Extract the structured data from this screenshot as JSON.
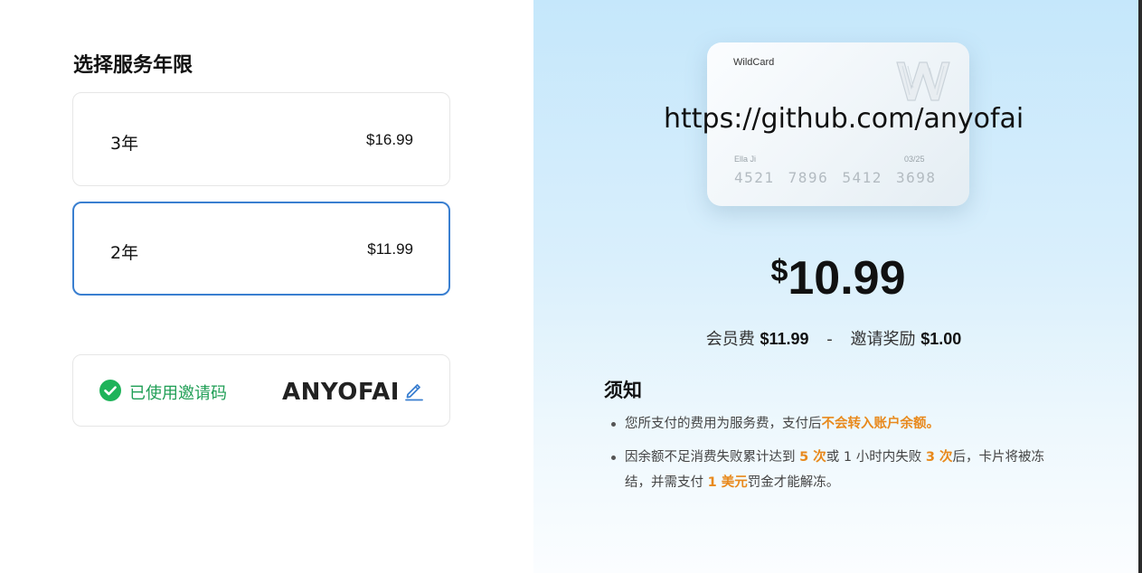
{
  "plan_section": {
    "title": "选择服务年限",
    "options": [
      {
        "label": "3年",
        "price": "$16.99",
        "selected": false
      },
      {
        "label": "2年",
        "price": "$11.99",
        "selected": true
      }
    ]
  },
  "invite": {
    "status_text": "已使用邀请码",
    "code": "ANYOFAI",
    "status_icon": "check-circle-icon",
    "edit_icon": "pencil-icon"
  },
  "card": {
    "brand": "WildCard",
    "logo_icon": "w-logo-icon",
    "holder": "Ella Ji",
    "expiry": "03/25",
    "number": "4521 7896 5412 3698"
  },
  "watermark": "https://github.com/anyofai",
  "summary": {
    "currency": "$",
    "amount": "10.99",
    "fee_label": "会员费",
    "fee_value": "$11.99",
    "separator": "-",
    "reward_label": "邀请奖励",
    "reward_value": "$1.00"
  },
  "notice": {
    "title": "须知",
    "item1": {
      "text_a": "您所支付的费用为服务费，支付后",
      "highlight_a": "不会转入账户余额。"
    },
    "item2": {
      "text_a": "因余额不足消费失败累计达到 ",
      "highlight_a": "5 次",
      "text_b": "或 1 小时内失败 ",
      "highlight_b": "3 次",
      "text_c": "后，卡片将被冻结，并需支付 ",
      "highlight_c": "1 美元",
      "text_d": "罚金才能解冻。"
    }
  },
  "colors": {
    "accent_blue": "#3a7fd0",
    "success_green": "#1f9e55",
    "highlight_orange": "#e8891c"
  }
}
